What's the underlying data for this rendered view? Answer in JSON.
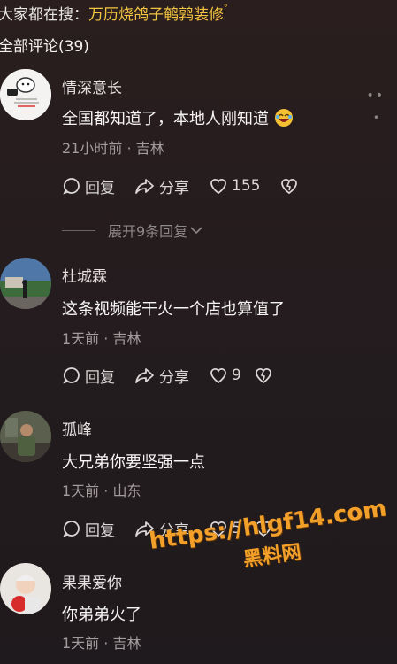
{
  "search": {
    "prefix": "大家都在搜：",
    "keyword": "万历烧鸽子鹌鹑装修"
  },
  "comments_header": "全部评论(39)",
  "actions": {
    "reply": "回复",
    "share": "分享"
  },
  "comments": [
    {
      "username": "情深意长",
      "content": "全国都知道了，本地人刚知道",
      "meta": "21小时前 · 吉林",
      "likes": "155",
      "expand": "展开9条回复"
    },
    {
      "username": "杜城霖",
      "content": "这条视频能干火一个店也算值了",
      "meta": "1天前 · 吉林",
      "likes": "9"
    },
    {
      "username": "孤峰",
      "content": "大兄弟你要坚强一点",
      "meta": "1天前 · 山东",
      "likes": "5"
    },
    {
      "username": "果果爱你",
      "content": "你弟弟火了",
      "meta": "1天前 · 吉林"
    }
  ],
  "watermark": {
    "url": "https://hlgf14.com",
    "name": "黑料网"
  },
  "colors": {
    "keyword": "#f4c542",
    "watermark": "#f2a02a",
    "meta": "#a39c9d"
  }
}
